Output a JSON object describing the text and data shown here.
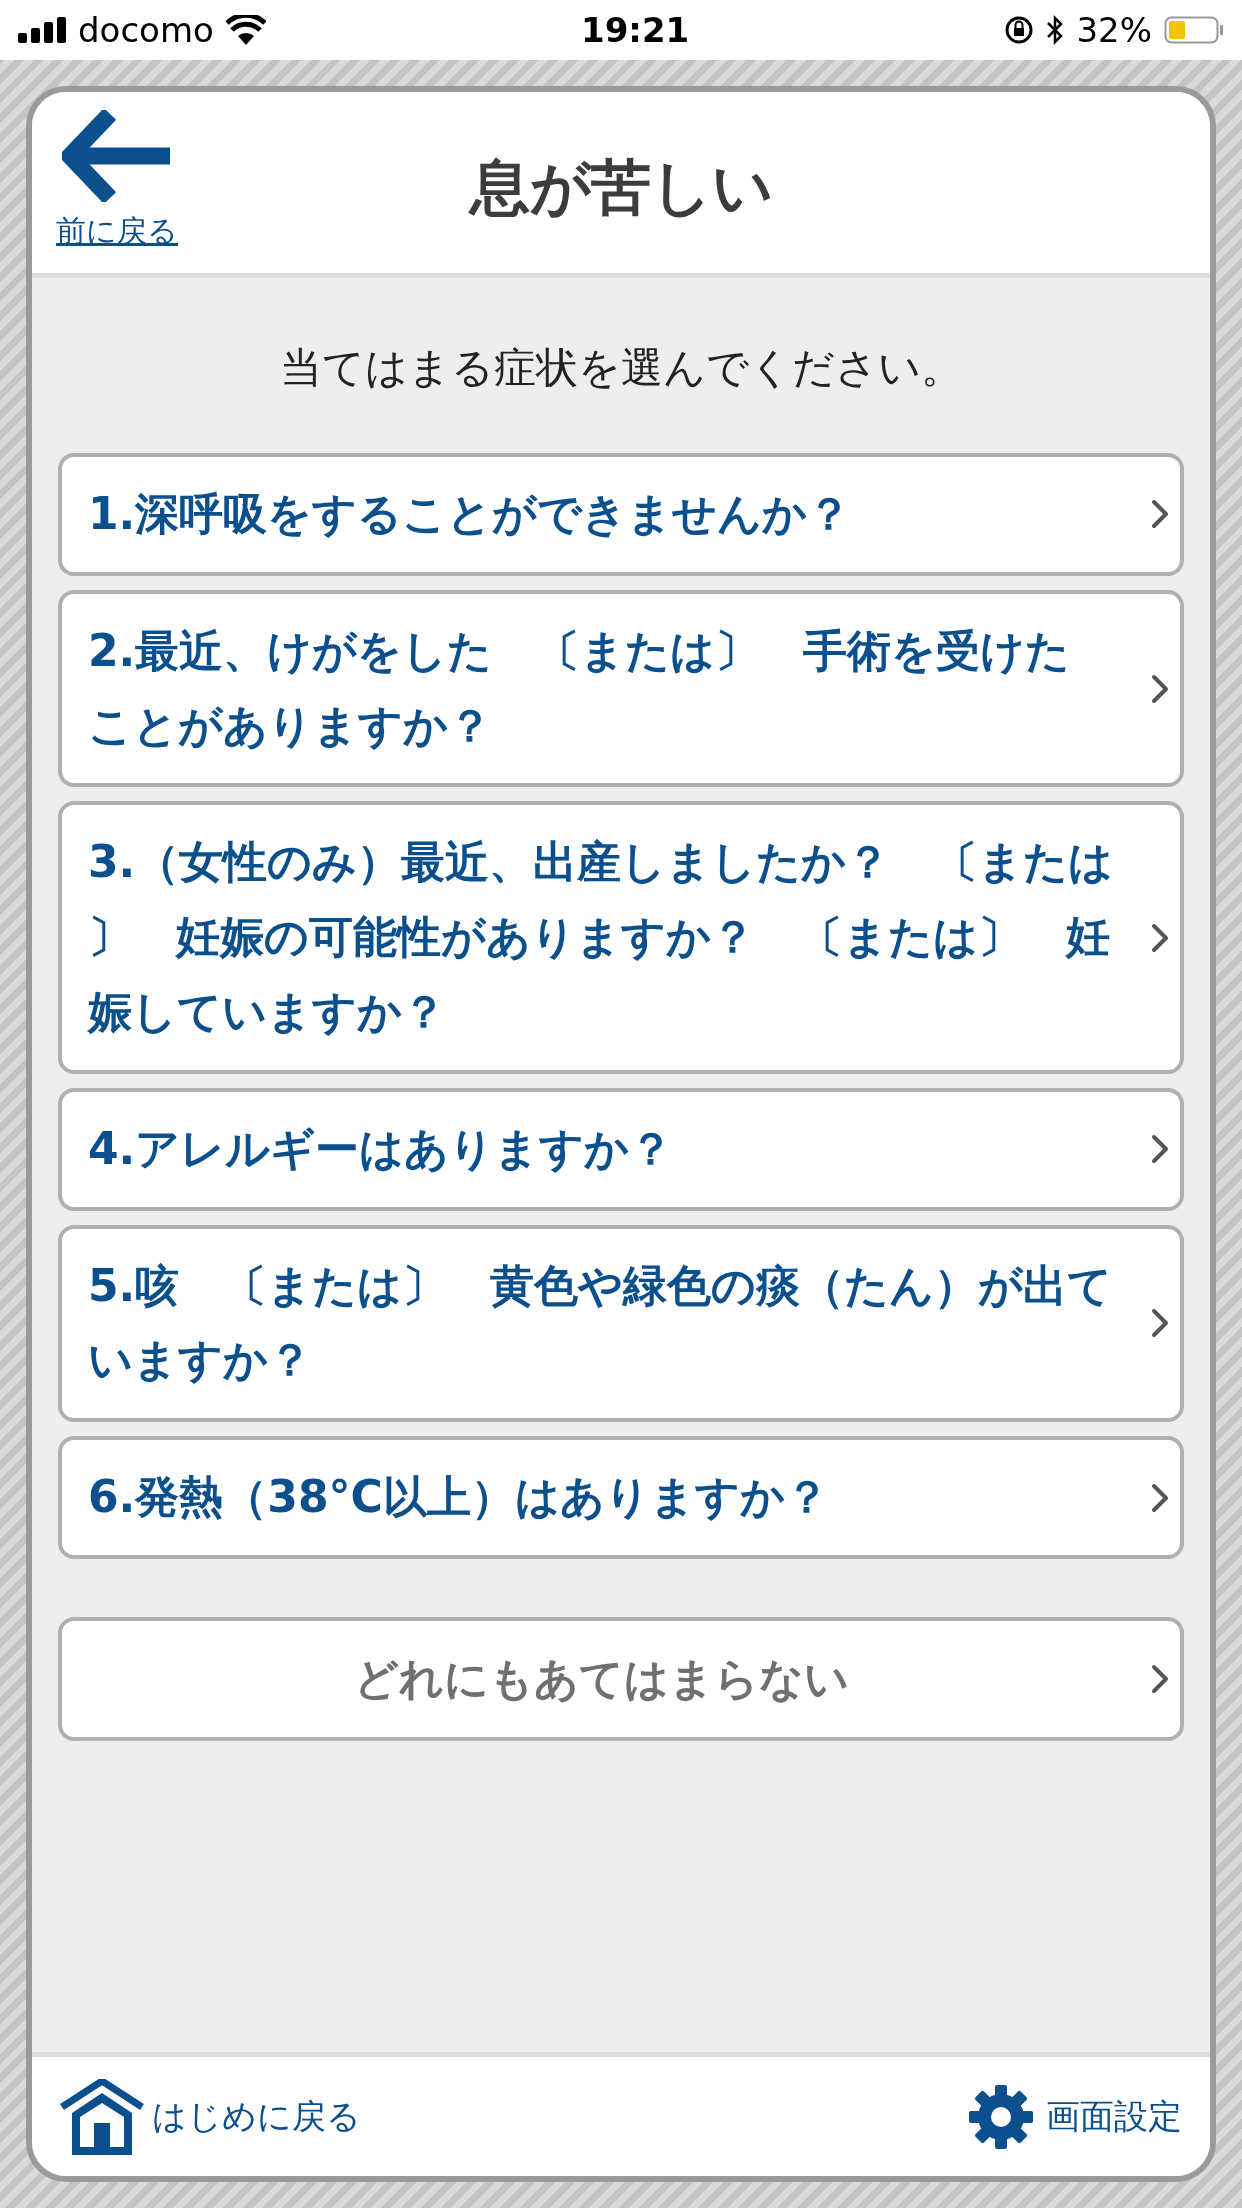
{
  "status_bar": {
    "carrier": "docomo",
    "time": "19:21",
    "battery": "32%"
  },
  "header": {
    "back_label": "前に戻る",
    "title": "息が苦しい"
  },
  "instruction": "当てはまる症状を選んでください。",
  "options": [
    {
      "kind": "question",
      "text": "1.深呼吸をすることができませんか？"
    },
    {
      "kind": "question",
      "text": "2.最近、けがをした　〔または〕　手術を受けたことがありますか？"
    },
    {
      "kind": "question",
      "text": "3.（女性のみ）最近、出産しましたか？　〔または〕　妊娠の可能性がありますか？　〔または〕　妊娠していますか？"
    },
    {
      "kind": "question",
      "text": "4.アレルギーはありますか？"
    },
    {
      "kind": "question",
      "text": "5.咳　〔または〕　黄色や緑色の痰（たん）が出ていますか？"
    },
    {
      "kind": "question",
      "text": "6.発熱（38°C以上）はありますか？"
    },
    {
      "kind": "none",
      "text": "どれにもあてはまらない"
    }
  ],
  "footer": {
    "home_label": "はじめに戻る",
    "settings_label": "画面設定"
  }
}
